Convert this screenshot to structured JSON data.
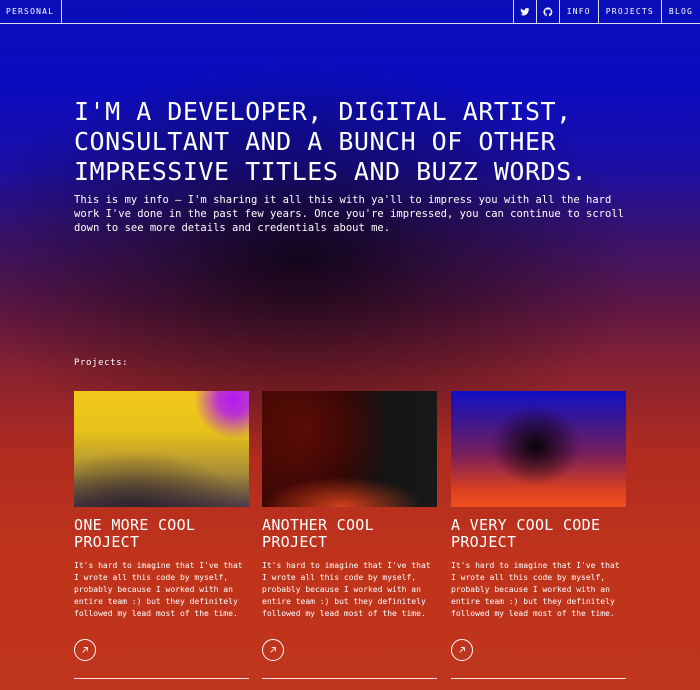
{
  "nav": {
    "brand": "PERSONAL",
    "icons": [
      "twitter-icon",
      "github-icon"
    ],
    "links": [
      "INFO",
      "PROJECTS",
      "BLOG"
    ]
  },
  "hero": {
    "title": "I'M A DEVELOPER, DIGITAL ARTIST, CONSULTANT AND A BUNCH OF OTHER IMPRESSIVE TITLES AND BUZZ WORDS.",
    "text": "This is my info — I'm sharing it all this with ya'll to impress you with all the hard work I've done in the past few years. Once you're impressed, you can continue to scroll down to see more details and credentials about me."
  },
  "projects": {
    "label": "Projects:",
    "items": [
      {
        "title": "ONE MORE COOL PROJECT",
        "text": "It's hard to imagine that I've that I wrote all this code by myself, probably because I worked with an entire team :) but they definitely followed my lead most of the time."
      },
      {
        "title": "ANOTHER COOL PROJECT",
        "text": "It's hard to imagine that I've that I wrote all this code by myself, probably because I worked with an entire team :) but they definitely followed my lead most of the time."
      },
      {
        "title": "A VERY COOL CODE PROJECT",
        "text": "It's hard to imagine that I've that I wrote all this code by myself, probably because I worked with an entire team :) but they definitely followed my lead most of the time."
      }
    ]
  },
  "colors": {
    "text": "#ffffff",
    "top_blue": "#0b0cc0",
    "bottom_orange": "#c0351d"
  }
}
